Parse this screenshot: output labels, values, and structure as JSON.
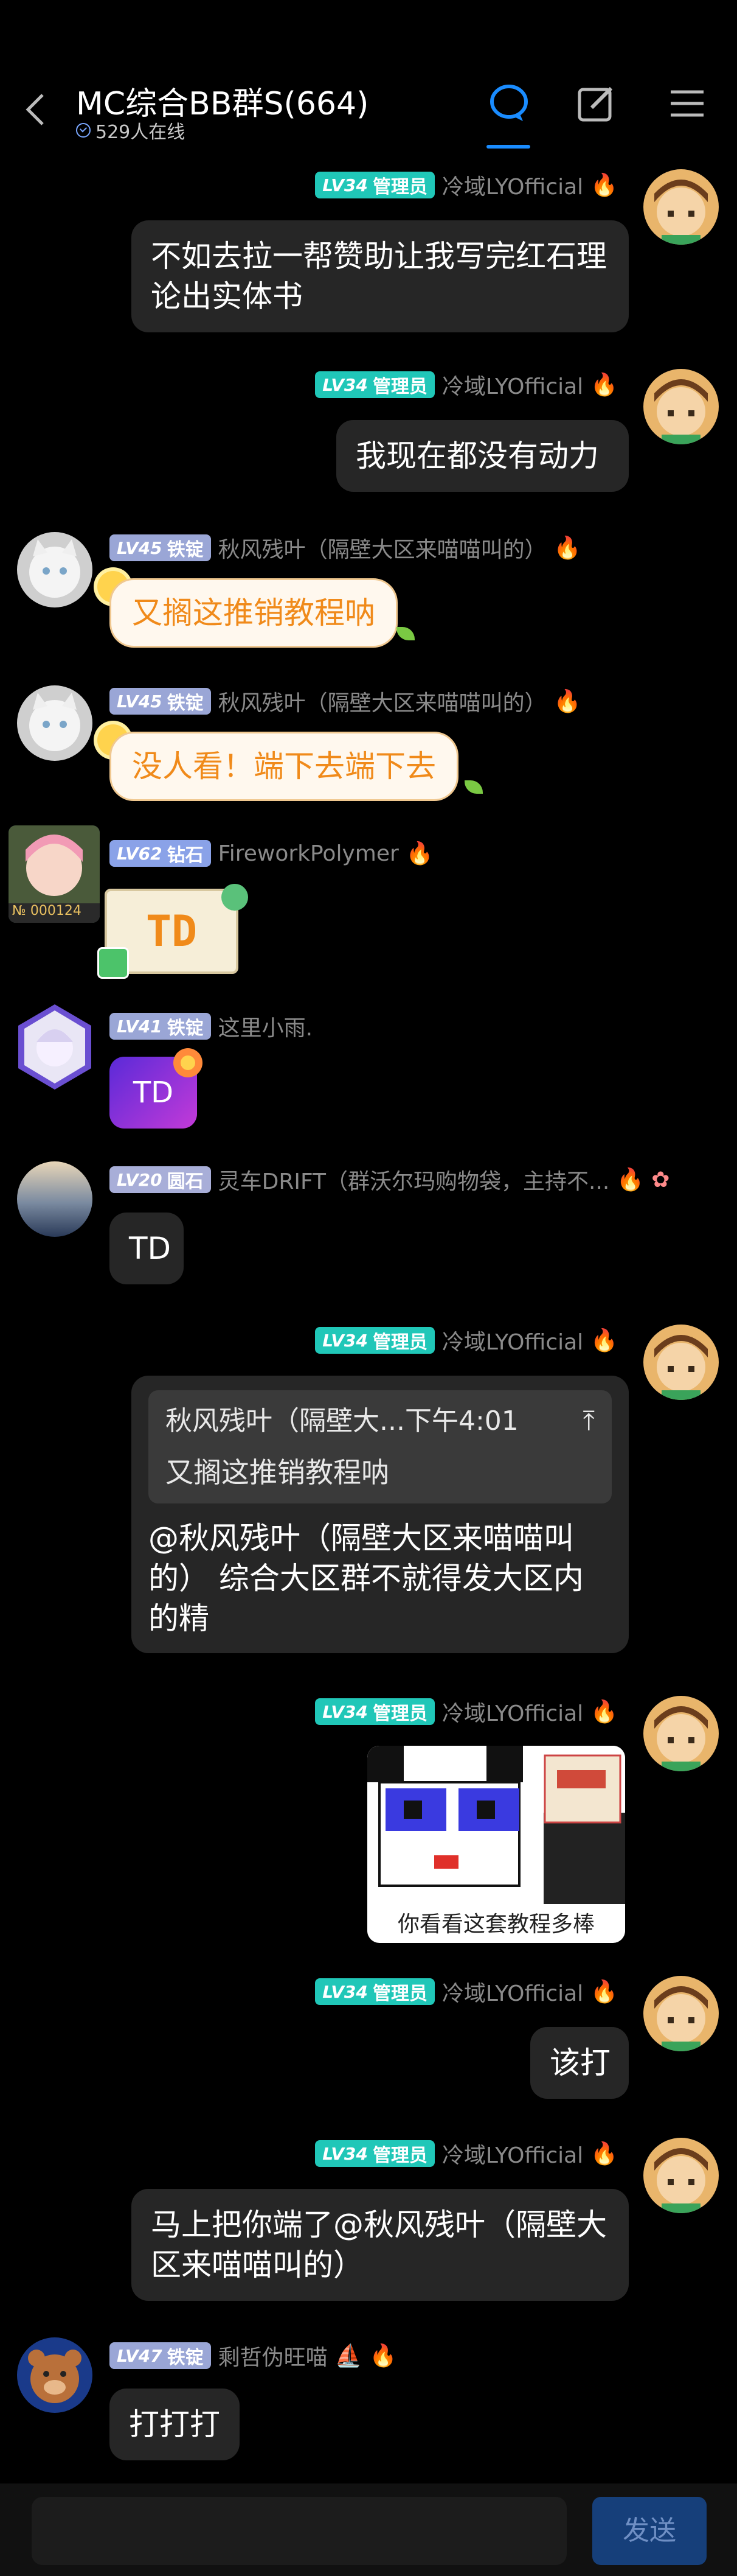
{
  "header": {
    "title": "MC综合BB群S(664)",
    "online": "529人在线"
  },
  "messages": [
    {
      "sender": "冷域LYOfficial",
      "level": "LV34",
      "badge": "管理员",
      "text": "不如去拉一帮赞助让我写完红石理论出实体书"
    },
    {
      "sender": "冷域LYOfficial",
      "level": "LV34",
      "badge": "管理员",
      "text": "我现在都没有动力"
    },
    {
      "sender": "秋风残叶（隔壁大区来喵喵叫的）",
      "level": "LV45",
      "badge": "铁锭",
      "text": "又搁这推销教程呐"
    },
    {
      "sender": "秋风残叶（隔壁大区来喵喵叫的）",
      "level": "LV45",
      "badge": "铁锭",
      "text": "没人看！端下去端下去"
    },
    {
      "sender": "FireworkPolymer",
      "level": "LV62",
      "badge": "钻石",
      "text": "TD",
      "avatar_tag": "№ 000124"
    },
    {
      "sender": "这里小雨.",
      "level": "LV41",
      "badge": "铁锭",
      "text": "TD"
    },
    {
      "sender": "灵车DRIFT（群沃尔玛购物袋，主持不...",
      "level": "LV20",
      "badge": "圆石",
      "text": "TD"
    },
    {
      "sender": "冷域LYOfficial",
      "level": "LV34",
      "badge": "管理员",
      "quote": {
        "author": "秋风残叶（隔壁大...",
        "time": "下午4:01",
        "text": "又搁这推销教程呐"
      },
      "text": "@秋风残叶（隔壁大区来喵喵叫的） 综合大区群不就得发大区内的精"
    },
    {
      "sender": "冷域LYOfficial",
      "level": "LV34",
      "badge": "管理员",
      "sticker_caption": "你看看这套教程多棒"
    },
    {
      "sender": "冷域LYOfficial",
      "level": "LV34",
      "badge": "管理员",
      "text": "该打"
    },
    {
      "sender": "冷域LYOfficial",
      "level": "LV34",
      "badge": "管理员",
      "text": "马上把你端了@秋风残叶（隔壁大区来喵喵叫的）"
    },
    {
      "sender": "剩哲伪旺喵",
      "level": "LV47",
      "badge": "铁锭",
      "text": "打打打"
    }
  ],
  "input": {
    "send_label": "发送"
  },
  "icons": [
    "back-icon",
    "chat-icon",
    "edit-icon",
    "menu-icon",
    "flame-icon"
  ],
  "colors": {
    "admin": "#20c7b8",
    "iron": "#9aa6d6",
    "accent": "#1a8cff",
    "bubble": "#262626"
  }
}
